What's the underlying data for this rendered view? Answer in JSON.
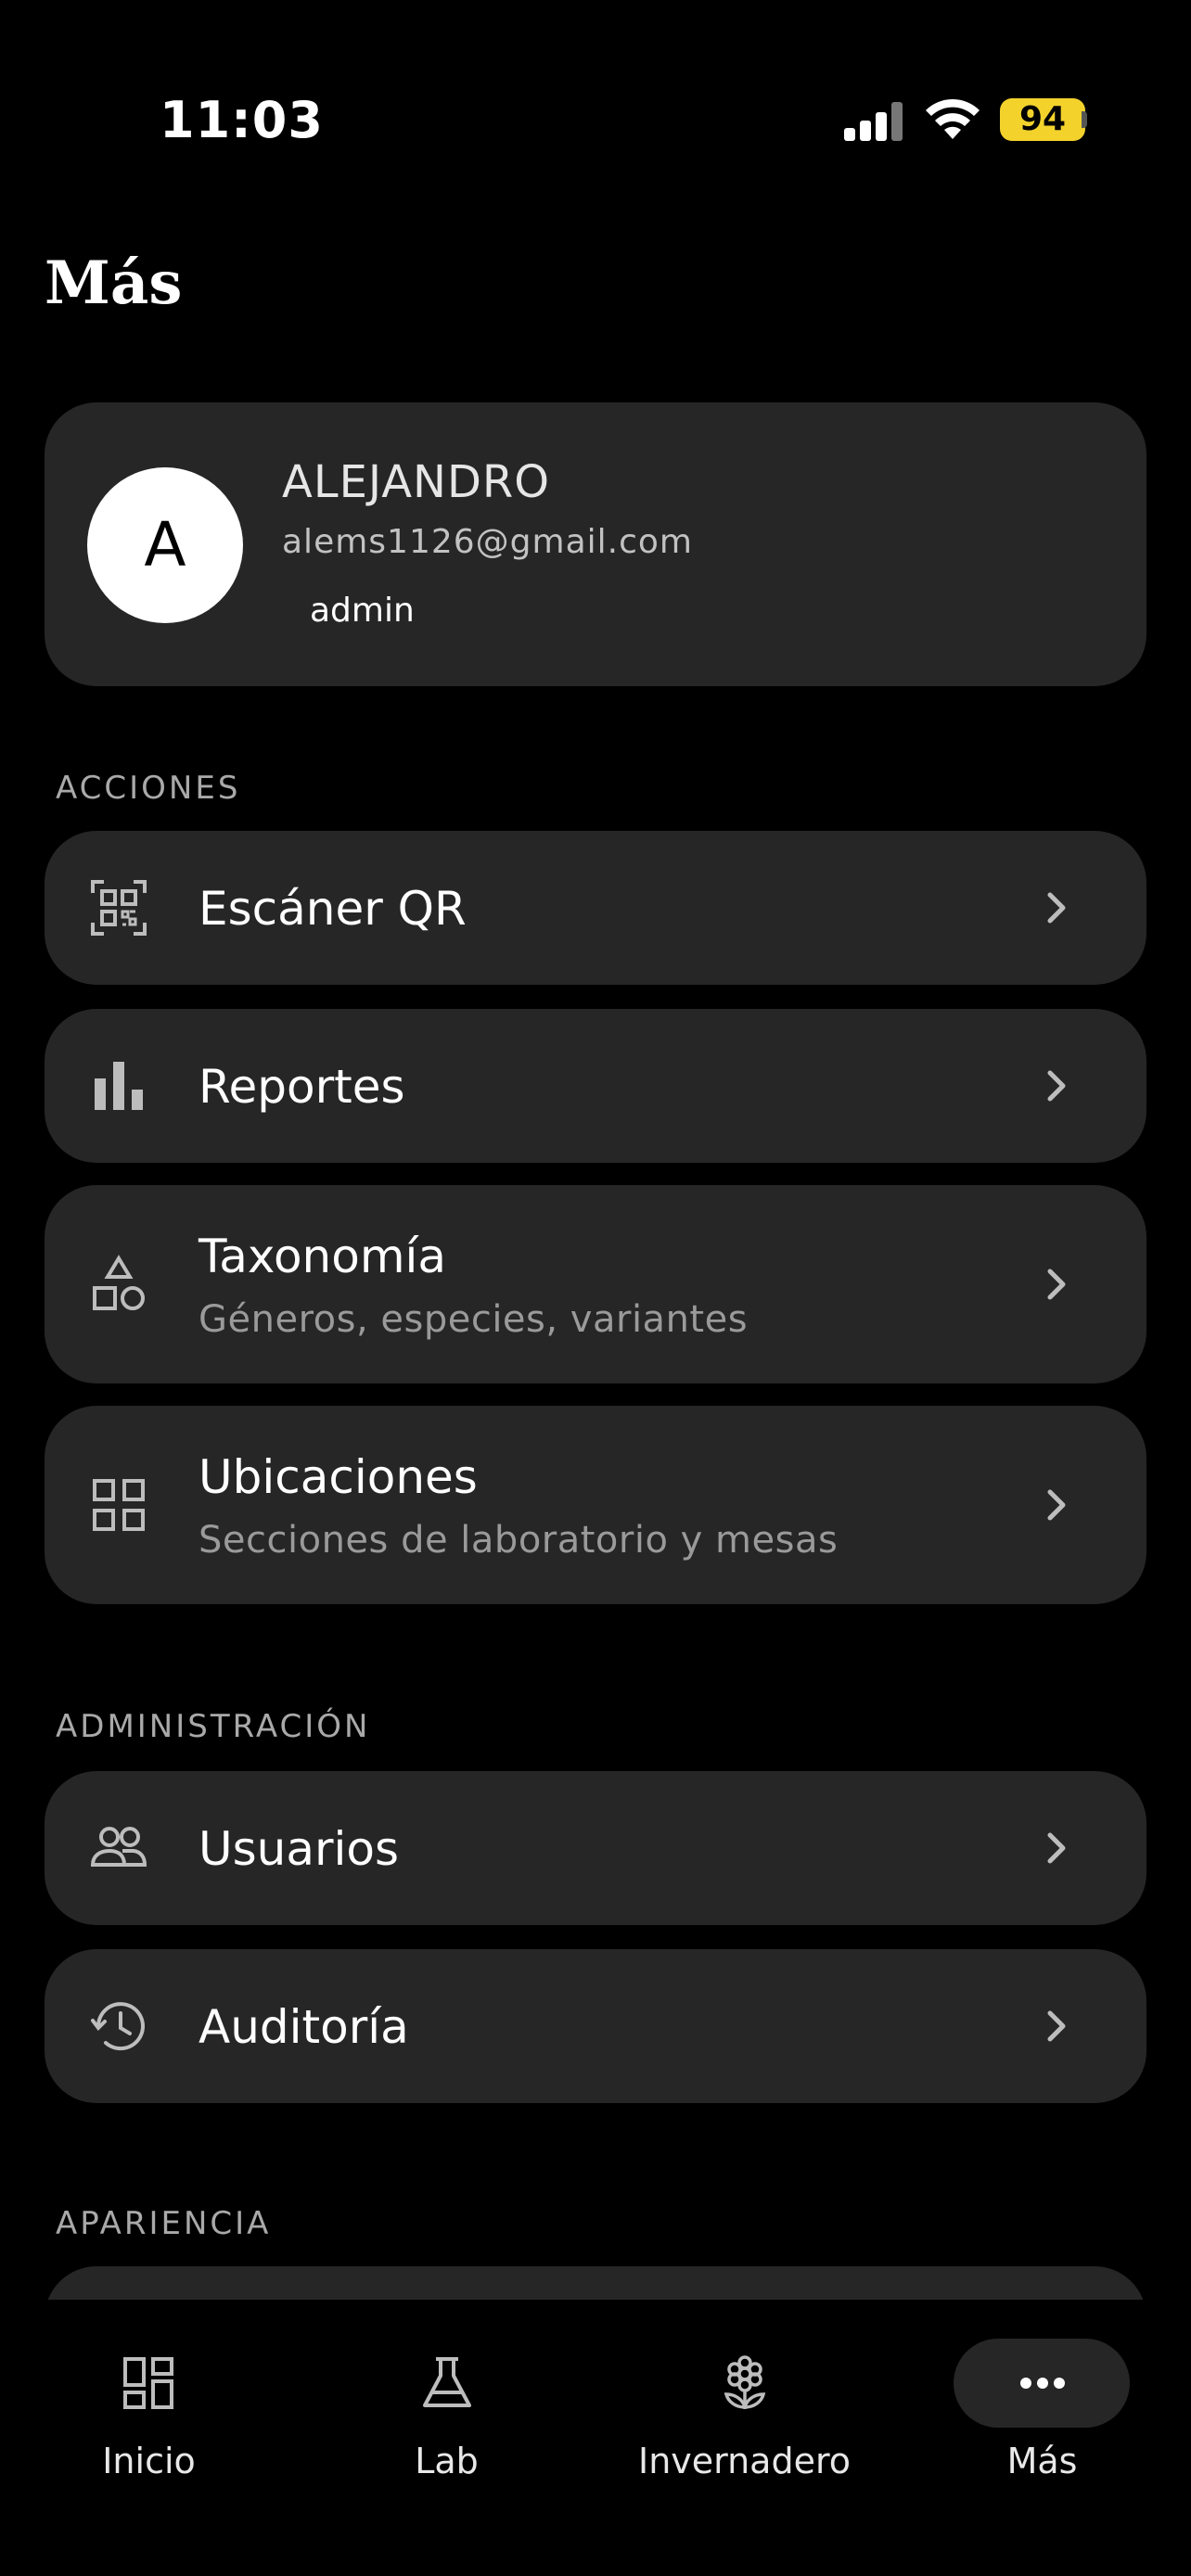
{
  "status_bar": {
    "time": "11:03",
    "battery": "94"
  },
  "page": {
    "title": "Más"
  },
  "profile": {
    "avatar_letter": "A",
    "name": "ALEJANDRO",
    "email": "alems1126@gmail.com",
    "role": "admin"
  },
  "sections": {
    "acciones": "ACCIONES",
    "administracion": "ADMINISTRACIÓN",
    "apariencia": "APARIENCIA"
  },
  "acciones_items": [
    {
      "title": "Escáner QR",
      "icon": "qr-scan-icon"
    },
    {
      "title": "Reportes",
      "icon": "bar-chart-icon"
    },
    {
      "title": "Taxonomía",
      "subtitle": "Géneros, especies, variantes",
      "icon": "shapes-icon"
    },
    {
      "title": "Ubicaciones",
      "subtitle": "Secciones de laboratorio y mesas",
      "icon": "grid-icon"
    }
  ],
  "admin_items": [
    {
      "title": "Usuarios",
      "icon": "users-icon"
    },
    {
      "title": "Auditoría",
      "icon": "history-icon"
    }
  ],
  "bottom_nav": [
    {
      "label": "Inicio",
      "icon": "dashboard-icon"
    },
    {
      "label": "Lab",
      "icon": "flask-icon"
    },
    {
      "label": "Invernadero",
      "icon": "flower-icon"
    },
    {
      "label": "Más",
      "icon": "more-dots-icon",
      "active": true
    }
  ],
  "colors": {
    "background": "#000000",
    "card": "#262626",
    "battery": "#f3d22c",
    "muted_text": "#9a9a9a"
  }
}
